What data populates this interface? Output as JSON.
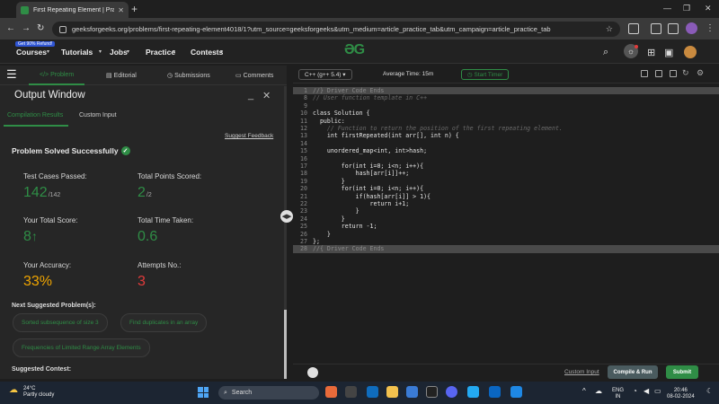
{
  "browser": {
    "tab_title": "First Repeating Element | Practice",
    "url": "geeksforgeeks.org/problems/first-repeating-element4018/1?utm_source=geeksforgeeks&utm_medium=article_practice_tab&utm_campaign=article_practice_tab"
  },
  "site_nav": {
    "promo": "Get 90% Refund!",
    "items": [
      "Courses",
      "Tutorials",
      "Jobs",
      "Practice",
      "Contests"
    ]
  },
  "left_tabs": [
    "Problem",
    "Editorial",
    "Submissions",
    "Comments"
  ],
  "output": {
    "title": "Output Window",
    "subtabs": [
      "Compilation Results",
      "Custom Input"
    ],
    "suggest_feedback": "Suggest Feedback",
    "status": "Problem Solved Successfully",
    "stats": {
      "tests_label": "Test Cases Passed:",
      "tests_value": "142",
      "tests_total": "/142",
      "points_label": "Total Points Scored:",
      "points_value": "2",
      "points_total": "/2",
      "score_label": "Your Total Score:",
      "score_value": "8",
      "time_label": "Total Time Taken:",
      "time_value": "0.6",
      "accuracy_label": "Your Accuracy:",
      "accuracy_value": "33%",
      "attempts_label": "Attempts No.:",
      "attempts_value": "3"
    },
    "next_suggested_label": "Next Suggested Problem(s):",
    "suggested": [
      "Sorted subsequence of size 3",
      "Find duplicates in an array",
      "Frequencies of Limited Range Array Elements"
    ],
    "suggested_contest_label": "Suggested Contest:"
  },
  "editor": {
    "language": "C++ (g++ 5.4)",
    "avg_time": "Average Time: 15m",
    "timer": "Start Timer",
    "lines": [
      {
        "n": "1",
        "t": "//} Driver Code Ends",
        "hl": true
      },
      {
        "n": "8",
        "t": "// User function template in C++",
        "cmt": true
      },
      {
        "n": "9",
        "t": ""
      },
      {
        "n": "10",
        "t": "class Solution {"
      },
      {
        "n": "11",
        "t": "  public:"
      },
      {
        "n": "12",
        "t": "    // Function to return the position of the first repeating element.",
        "cmt": true
      },
      {
        "n": "13",
        "t": "    int firstRepeated(int arr[], int n) {"
      },
      {
        "n": "14",
        "t": ""
      },
      {
        "n": "15",
        "t": "    unordered_map<int, int>hash;"
      },
      {
        "n": "16",
        "t": ""
      },
      {
        "n": "17",
        "t": "        for(int i=0; i<n; i++){"
      },
      {
        "n": "18",
        "t": "            hash[arr[i]]++;"
      },
      {
        "n": "19",
        "t": "        }"
      },
      {
        "n": "20",
        "t": "        for(int i=0; i<n; i++){"
      },
      {
        "n": "21",
        "t": "            if(hash[arr[i]] > 1){"
      },
      {
        "n": "22",
        "t": "                return i+1;"
      },
      {
        "n": "23",
        "t": "            }"
      },
      {
        "n": "24",
        "t": "        }"
      },
      {
        "n": "25",
        "t": "        return -1;"
      },
      {
        "n": "26",
        "t": "    }"
      },
      {
        "n": "27",
        "t": "};"
      },
      {
        "n": "28",
        "t": "//{ Driver Code Ends",
        "hl": true
      }
    ],
    "custom_input": "Custom Input",
    "compile": "Compile & Run",
    "submit": "Submit"
  },
  "taskbar": {
    "temp": "24°C",
    "weather": "Partly cloudy",
    "search": "Search",
    "lang": "ENG",
    "region": "IN",
    "time": "20:46",
    "date": "08-02-2024"
  },
  "colors": {
    "accent": "#2f8d46",
    "accuracy": "#f0a500",
    "attempts": "#e23b3b"
  }
}
